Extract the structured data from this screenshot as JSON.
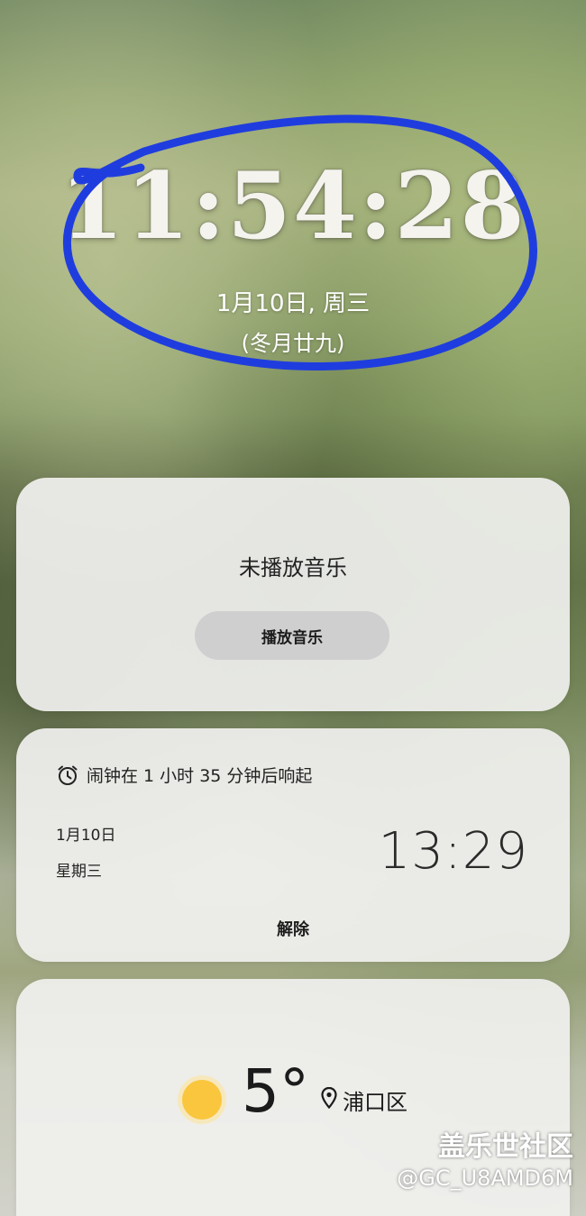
{
  "lockscreen": {
    "clock": "11:54:28",
    "date": "1月10日, 周三",
    "lunar_date": "(冬月廿九)"
  },
  "music_widget": {
    "status": "未播放音乐",
    "play_button_label": "播放音乐"
  },
  "alarm_widget": {
    "header": "闹钟在 1 小时 35 分钟后响起",
    "date": "1月10日",
    "weekday": "星期三",
    "time": "13:29",
    "dismiss_label": "解除"
  },
  "weather_widget": {
    "temperature": "5°",
    "location": "浦口区",
    "icon": "sun-icon"
  },
  "watermark": {
    "community": "盖乐世社区",
    "user": "@GC_U8AMD6M"
  },
  "colors": {
    "annotation_stroke": "#1f3dde",
    "sun": "#f9c63e",
    "card_bg": "#f0f0ee"
  }
}
